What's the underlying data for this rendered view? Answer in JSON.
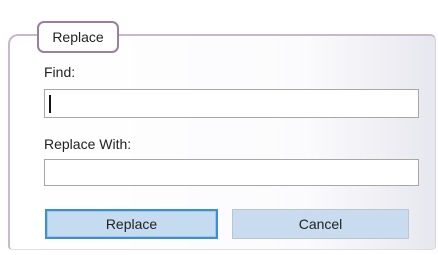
{
  "dialog": {
    "tab_label": "Replace",
    "find_label": "Find:",
    "find_value": "",
    "replace_label": "Replace With:",
    "replace_value": "",
    "replace_button": "Replace",
    "cancel_button": "Cancel"
  }
}
